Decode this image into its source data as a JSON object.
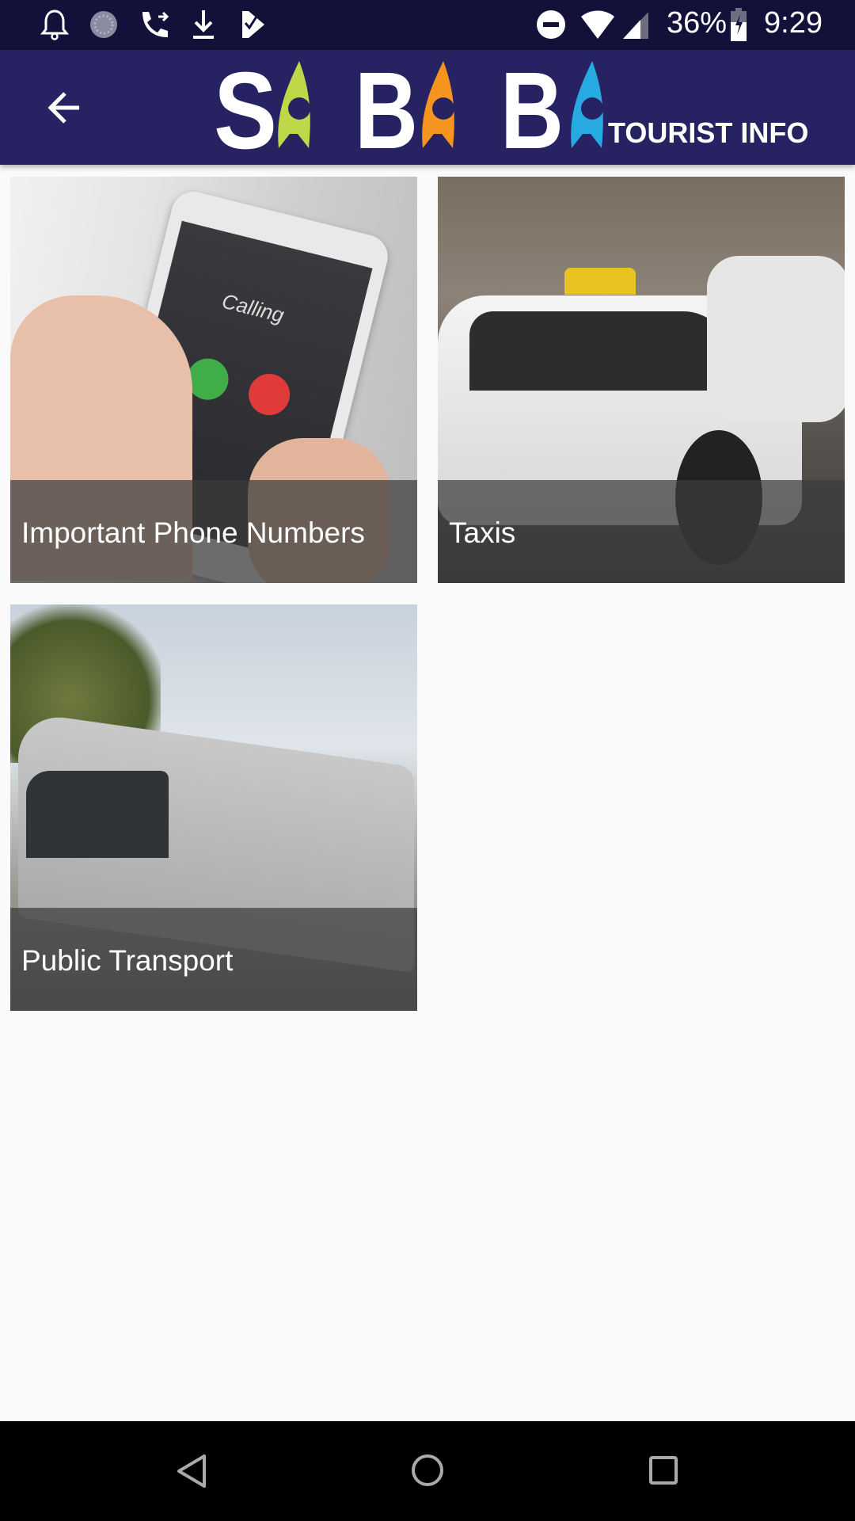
{
  "status_bar": {
    "left_icons": [
      "bell-icon",
      "sync-icon",
      "call-forward-icon",
      "download-icon",
      "task-check-icon"
    ],
    "right_icons": [
      "do-not-disturb-icon",
      "wifi-icon",
      "signal-icon",
      "battery-charging-icon"
    ],
    "battery": "36%",
    "time": "9:29"
  },
  "toolbar": {
    "back_icon": "arrow-left-icon",
    "logo_text": "SABABA",
    "subtitle": "TOURIST INFO",
    "brand_colors": {
      "background": "#272261",
      "green": "#bfd849",
      "orange": "#f5951f",
      "blue": "#27a9e1"
    }
  },
  "tiles": [
    {
      "label": "Important Phone Numbers"
    },
    {
      "label": "Taxis"
    },
    {
      "label": "Public Transport"
    }
  ],
  "nav_bar": {
    "icons": [
      "back-triangle-icon",
      "home-circle-icon",
      "recents-square-icon"
    ]
  }
}
